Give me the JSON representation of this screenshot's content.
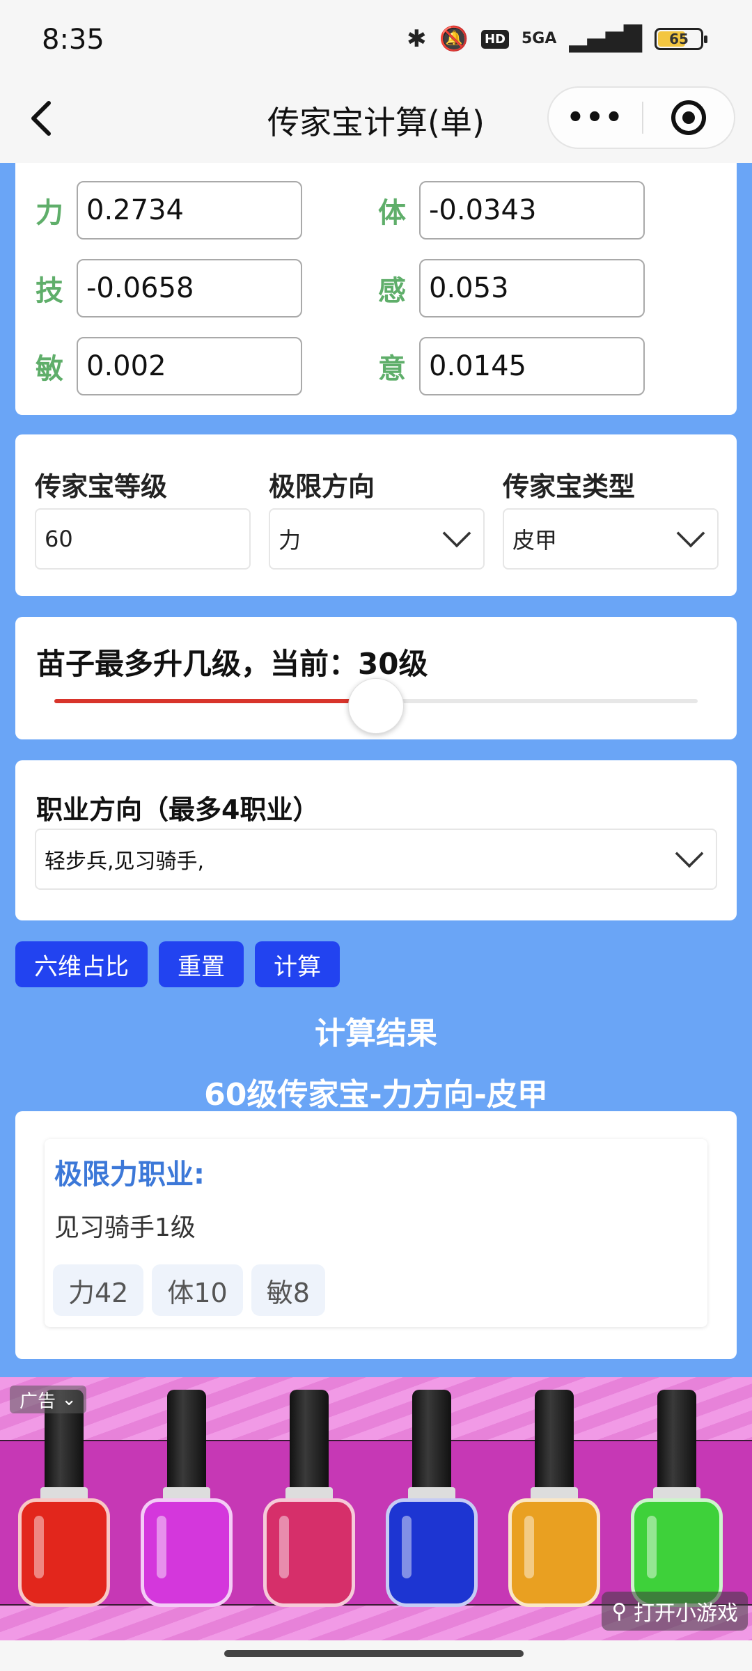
{
  "status": {
    "time": "8:35",
    "network": "5GA",
    "battery": "65",
    "battery_level": 0.65
  },
  "nav": {
    "back_icon": "chevron-left-icon",
    "title": "传家宝计算(单)",
    "more": "•••",
    "target_icon": "target-icon"
  },
  "attributes": [
    {
      "label": "力",
      "value": "0.2734"
    },
    {
      "label": "体",
      "value": "-0.0343"
    },
    {
      "label": "技",
      "value": "-0.0658"
    },
    {
      "label": "感",
      "value": "0.053"
    },
    {
      "label": "敏",
      "value": "0.002"
    },
    {
      "label": "意",
      "value": "0.0145"
    }
  ],
  "settings": {
    "level_label": "传家宝等级",
    "level_value": "60",
    "direction_label": "极限方向",
    "direction_value": "力",
    "type_label": "传家宝类型",
    "type_value": "皮甲"
  },
  "slider": {
    "title": "苗子最多升几级，当前：30级",
    "value": 30,
    "min": 0,
    "max": 60
  },
  "job": {
    "label": "职业方向（最多4职业）",
    "value": "轻步兵,见习骑手,"
  },
  "buttons": {
    "ratio": "六维占比",
    "reset": "重置",
    "calc": "计算"
  },
  "result": {
    "heading": "计算结果",
    "subheading": "60级传家宝-力方向-皮甲",
    "card_title": "极限力职业:",
    "job_line": "见习骑手1级",
    "tags": [
      "力42",
      "体10",
      "敏8"
    ]
  },
  "ad": {
    "label": "广告",
    "open": "打开小游戏",
    "bottle_colors": [
      "#e2261c",
      "#d437dc",
      "#d62f6a",
      "#1d35d2",
      "#e9a021",
      "#3ed13a"
    ]
  },
  "colors": {
    "page_bg": "#6aa5f6",
    "button_bg": "#2243f0",
    "attr_label": "#5fae6a",
    "result_title": "#3c78d8",
    "slider_fill": "#d8342b"
  }
}
